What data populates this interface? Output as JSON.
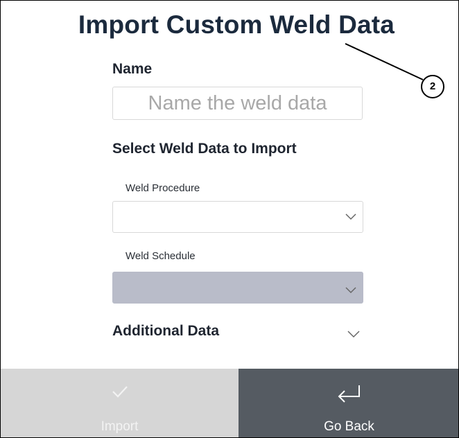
{
  "header": {
    "title": "Import Custom Weld Data"
  },
  "name_section": {
    "label": "Name",
    "placeholder": "Name the weld data",
    "value": ""
  },
  "select_section": {
    "label": "Select Weld Data to Import",
    "procedure_label": "Weld Procedure",
    "procedure_value": "",
    "schedule_label": "Weld Schedule",
    "schedule_value": ""
  },
  "additional": {
    "label": "Additional Data"
  },
  "annotation": {
    "number": "2"
  },
  "footer": {
    "import_label": "Import",
    "import_icon": "checkmark-icon",
    "back_label": "Go Back",
    "back_icon": "return-arrow-icon"
  },
  "colors": {
    "title": "#1b2a3d",
    "disabled_dropdown": "#b9bcc9",
    "import_button_bg": "#d6d6d6",
    "back_button_bg": "#555b62"
  }
}
